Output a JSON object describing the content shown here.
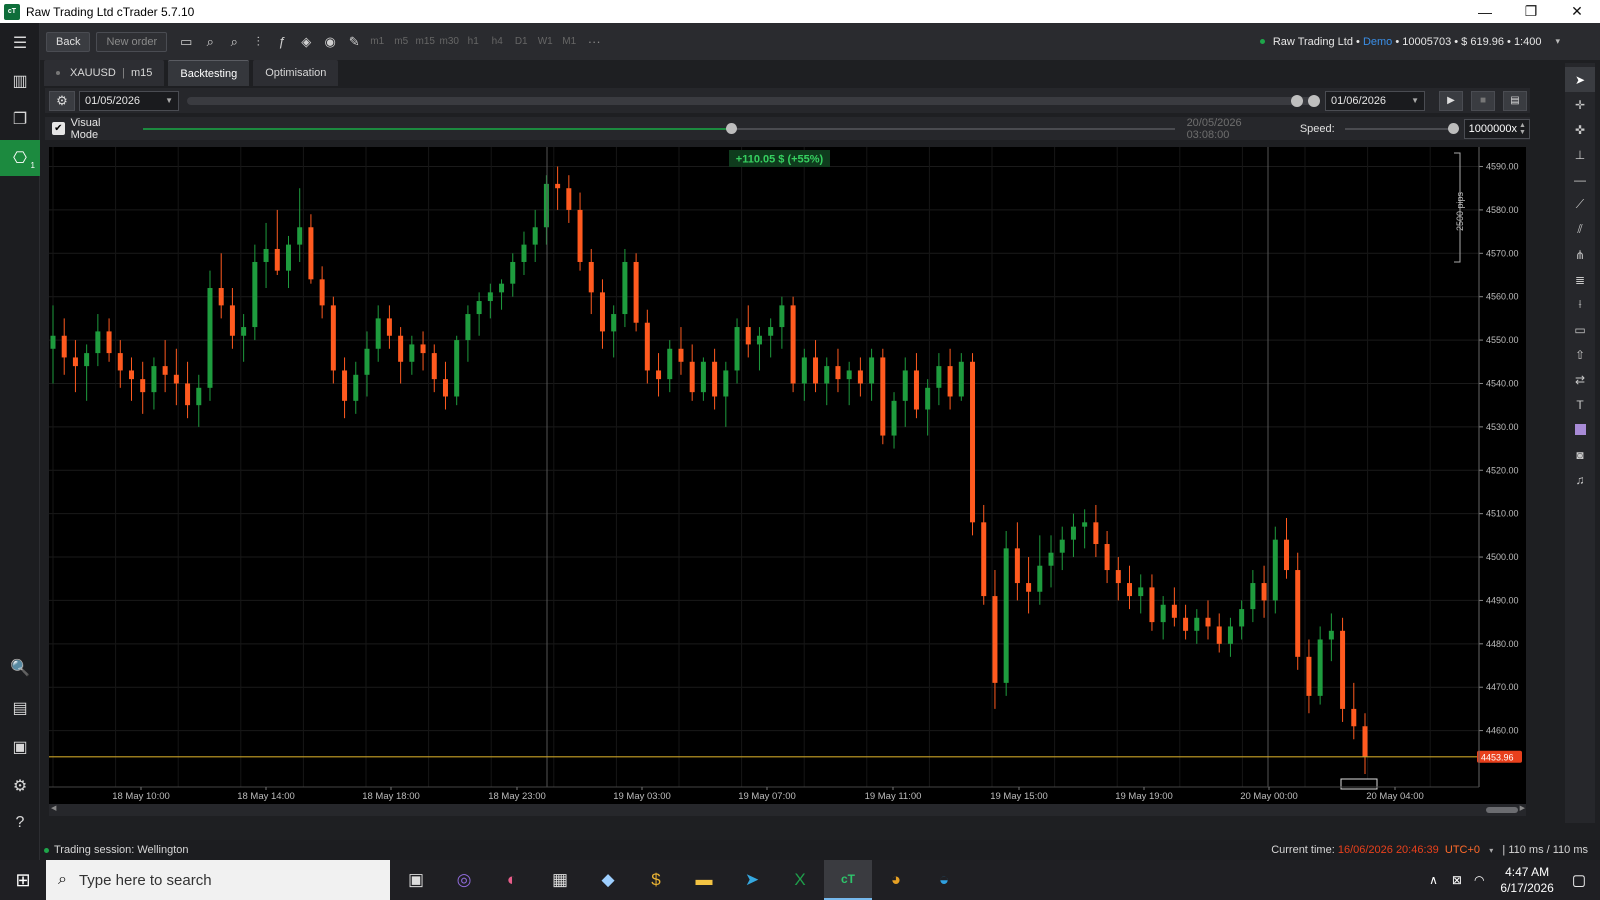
{
  "window": {
    "title": "Raw Trading Ltd cTrader 5.7.10",
    "logo": "cT",
    "minimize": "—",
    "restore": "❐",
    "close": "✕"
  },
  "toolbar": {
    "back": "Back",
    "new_order": "New order",
    "timeframes": [
      "m1",
      "m5",
      "m15",
      "m30",
      "h1",
      "h4",
      "D1",
      "W1",
      "M1"
    ],
    "more": "···"
  },
  "account": {
    "broker": "Raw Trading Ltd",
    "bullet1": "•",
    "mode": "Demo",
    "rest": "• 10005703 • $ 619.96 • 1:400",
    "chevron": "▾"
  },
  "tabs": {
    "symbol": "XAUUSD",
    "timeframe": "m15",
    "backtesting": "Backtesting",
    "optimisation": "Optimisation"
  },
  "backtest": {
    "start_date": "01/05/2026",
    "end_date": "01/06/2026",
    "visual_mode_label": "Visual Mode",
    "visual_mode_checked": true,
    "current_date": "20/05/2026 03:08:00",
    "speed_label": "Speed:",
    "speed_value": "1000000x",
    "progress_fraction": 0.57
  },
  "chart_data": {
    "type": "candlestick",
    "symbol": "XAUUSD",
    "timeframe": "m15",
    "profit_label": "+110.05 $ (+55%)",
    "pips_label": "2500 pips",
    "current_price": "4453.96",
    "y_ticks": [
      4590,
      4580,
      4570,
      4560,
      4550,
      4540,
      4530,
      4520,
      4510,
      4500,
      4490,
      4480,
      4470,
      4460
    ],
    "ylim": [
      4447.0,
      4594.5
    ],
    "x_labels": [
      "18 May 10:00",
      "18 May 14:00",
      "18 May 18:00",
      "18 May 23:00",
      "19 May 03:00",
      "19 May 07:00",
      "19 May 11:00",
      "19 May 15:00",
      "19 May 19:00",
      "20 May 00:00",
      "20 May 04:00"
    ],
    "bull_color": "#1e9c3e",
    "bear_color": "#ff5a1f",
    "price_line_color": "#c9a227",
    "candles": [
      [
        4548,
        4558,
        4540,
        4551
      ],
      [
        4551,
        4555,
        4542,
        4546
      ],
      [
        4546,
        4550,
        4538,
        4544
      ],
      [
        4544,
        4549,
        4536,
        4547
      ],
      [
        4547,
        4556,
        4544,
        4552
      ],
      [
        4552,
        4555,
        4545,
        4547
      ],
      [
        4547,
        4550,
        4539,
        4543
      ],
      [
        4543,
        4546,
        4536,
        4541
      ],
      [
        4541,
        4545,
        4533,
        4538
      ],
      [
        4538,
        4546,
        4534,
        4544
      ],
      [
        4544,
        4550,
        4538,
        4542
      ],
      [
        4542,
        4548,
        4535,
        4540
      ],
      [
        4540,
        4545,
        4532,
        4535
      ],
      [
        4535,
        4542,
        4530,
        4539
      ],
      [
        4539,
        4566,
        4536,
        4562
      ],
      [
        4562,
        4570,
        4555,
        4558
      ],
      [
        4558,
        4562,
        4548,
        4551
      ],
      [
        4551,
        4556,
        4545,
        4553
      ],
      [
        4553,
        4572,
        4550,
        4568
      ],
      [
        4568,
        4577,
        4562,
        4571
      ],
      [
        4571,
        4580,
        4565,
        4566
      ],
      [
        4566,
        4574,
        4562,
        4572
      ],
      [
        4572,
        4585,
        4568,
        4576
      ],
      [
        4576,
        4579,
        4563,
        4564
      ],
      [
        4564,
        4567,
        4555,
        4558
      ],
      [
        4558,
        4560,
        4540,
        4543
      ],
      [
        4543,
        4546,
        4532,
        4536
      ],
      [
        4536,
        4545,
        4533,
        4542
      ],
      [
        4542,
        4552,
        4537,
        4548
      ],
      [
        4548,
        4558,
        4545,
        4555
      ],
      [
        4555,
        4558,
        4548,
        4551
      ],
      [
        4551,
        4553,
        4540,
        4545
      ],
      [
        4545,
        4551,
        4542,
        4549
      ],
      [
        4549,
        4552,
        4543,
        4547
      ],
      [
        4547,
        4549,
        4538,
        4541
      ],
      [
        4541,
        4545,
        4534,
        4537
      ],
      [
        4537,
        4551,
        4535,
        4550
      ],
      [
        4550,
        4558,
        4545,
        4556
      ],
      [
        4556,
        4561,
        4551,
        4559
      ],
      [
        4559,
        4563,
        4555,
        4561
      ],
      [
        4561,
        4564,
        4557,
        4563
      ],
      [
        4563,
        4570,
        4560,
        4568
      ],
      [
        4568,
        4575,
        4565,
        4572
      ],
      [
        4572,
        4580,
        4568,
        4576
      ],
      [
        4576,
        4588,
        4572,
        4586
      ],
      [
        4586,
        4590,
        4580,
        4585
      ],
      [
        4585,
        4588,
        4577,
        4580
      ],
      [
        4580,
        4584,
        4566,
        4568
      ],
      [
        4568,
        4571,
        4556,
        4561
      ],
      [
        4561,
        4564,
        4548,
        4552
      ],
      [
        4552,
        4558,
        4546,
        4556
      ],
      [
        4556,
        4571,
        4553,
        4568
      ],
      [
        4568,
        4570,
        4552,
        4554
      ],
      [
        4554,
        4557,
        4540,
        4543
      ],
      [
        4543,
        4547,
        4537,
        4541
      ],
      [
        4541,
        4550,
        4538,
        4548
      ],
      [
        4548,
        4553,
        4542,
        4545
      ],
      [
        4545,
        4549,
        4536,
        4538
      ],
      [
        4538,
        4546,
        4536,
        4545
      ],
      [
        4545,
        4548,
        4534,
        4537
      ],
      [
        4537,
        4545,
        4530,
        4543
      ],
      [
        4543,
        4555,
        4540,
        4553
      ],
      [
        4553,
        4558,
        4546,
        4549
      ],
      [
        4549,
        4553,
        4543,
        4551
      ],
      [
        4551,
        4555,
        4546,
        4553
      ],
      [
        4553,
        4560,
        4548,
        4558
      ],
      [
        4558,
        4560,
        4538,
        4540
      ],
      [
        4540,
        4548,
        4536,
        4546
      ],
      [
        4546,
        4550,
        4538,
        4540
      ],
      [
        4540,
        4546,
        4535,
        4544
      ],
      [
        4544,
        4548,
        4538,
        4541
      ],
      [
        4541,
        4545,
        4535,
        4543
      ],
      [
        4543,
        4546,
        4537,
        4540
      ],
      [
        4540,
        4548,
        4536,
        4546
      ],
      [
        4546,
        4548,
        4526,
        4528
      ],
      [
        4528,
        4538,
        4525,
        4536
      ],
      [
        4536,
        4546,
        4530,
        4543
      ],
      [
        4543,
        4547,
        4532,
        4534
      ],
      [
        4534,
        4541,
        4528,
        4539
      ],
      [
        4539,
        4547,
        4535,
        4544
      ],
      [
        4544,
        4548,
        4534,
        4537
      ],
      [
        4537,
        4547,
        4536,
        4545
      ],
      [
        4545,
        4547,
        4505,
        4508
      ],
      [
        4508,
        4512,
        4489,
        4491
      ],
      [
        4491,
        4497,
        4465,
        4471
      ],
      [
        4471,
        4506,
        4468,
        4502
      ],
      [
        4502,
        4508,
        4490,
        4494
      ],
      [
        4494,
        4500,
        4487,
        4492
      ],
      [
        4492,
        4505,
        4489,
        4498
      ],
      [
        4498,
        4505,
        4493,
        4501
      ],
      [
        4501,
        4507,
        4497,
        4504
      ],
      [
        4504,
        4510,
        4500,
        4507
      ],
      [
        4507,
        4511,
        4502,
        4508
      ],
      [
        4508,
        4512,
        4500,
        4503
      ],
      [
        4503,
        4506,
        4494,
        4497
      ],
      [
        4497,
        4500,
        4490,
        4494
      ],
      [
        4494,
        4498,
        4488,
        4491
      ],
      [
        4491,
        4496,
        4487,
        4493
      ],
      [
        4493,
        4496,
        4483,
        4485
      ],
      [
        4485,
        4491,
        4481,
        4489
      ],
      [
        4489,
        4493,
        4484,
        4486
      ],
      [
        4486,
        4489,
        4481,
        4483
      ],
      [
        4483,
        4488,
        4480,
        4486
      ],
      [
        4486,
        4490,
        4481,
        4484
      ],
      [
        4484,
        4487,
        4478,
        4480
      ],
      [
        4480,
        4486,
        4477,
        4484
      ],
      [
        4484,
        4490,
        4481,
        4488
      ],
      [
        4488,
        4497,
        4485,
        4494
      ],
      [
        4494,
        4498,
        4486,
        4490
      ],
      [
        4490,
        4507,
        4487,
        4504
      ],
      [
        4504,
        4509,
        4495,
        4497
      ],
      [
        4497,
        4501,
        4474,
        4477
      ],
      [
        4477,
        4481,
        4464,
        4468
      ],
      [
        4468,
        4484,
        4466,
        4481
      ],
      [
        4481,
        4487,
        4476,
        4483
      ],
      [
        4483,
        4486,
        4462,
        4465
      ],
      [
        4465,
        4471,
        4458,
        4461
      ],
      [
        4461,
        4464,
        4450,
        4454
      ]
    ]
  },
  "statusbar": {
    "session": "Trading session: Wellington",
    "current_time_label": "Current time:",
    "current_time": "16/06/2026 20:46:39",
    "timezone": "UTC+0",
    "tz_chevron": "▾",
    "latency": "| 110 ms / 110 ms"
  },
  "taskbar": {
    "search_placeholder": "Type here to search",
    "time": "4:47 AM",
    "date": "6/17/2026"
  }
}
